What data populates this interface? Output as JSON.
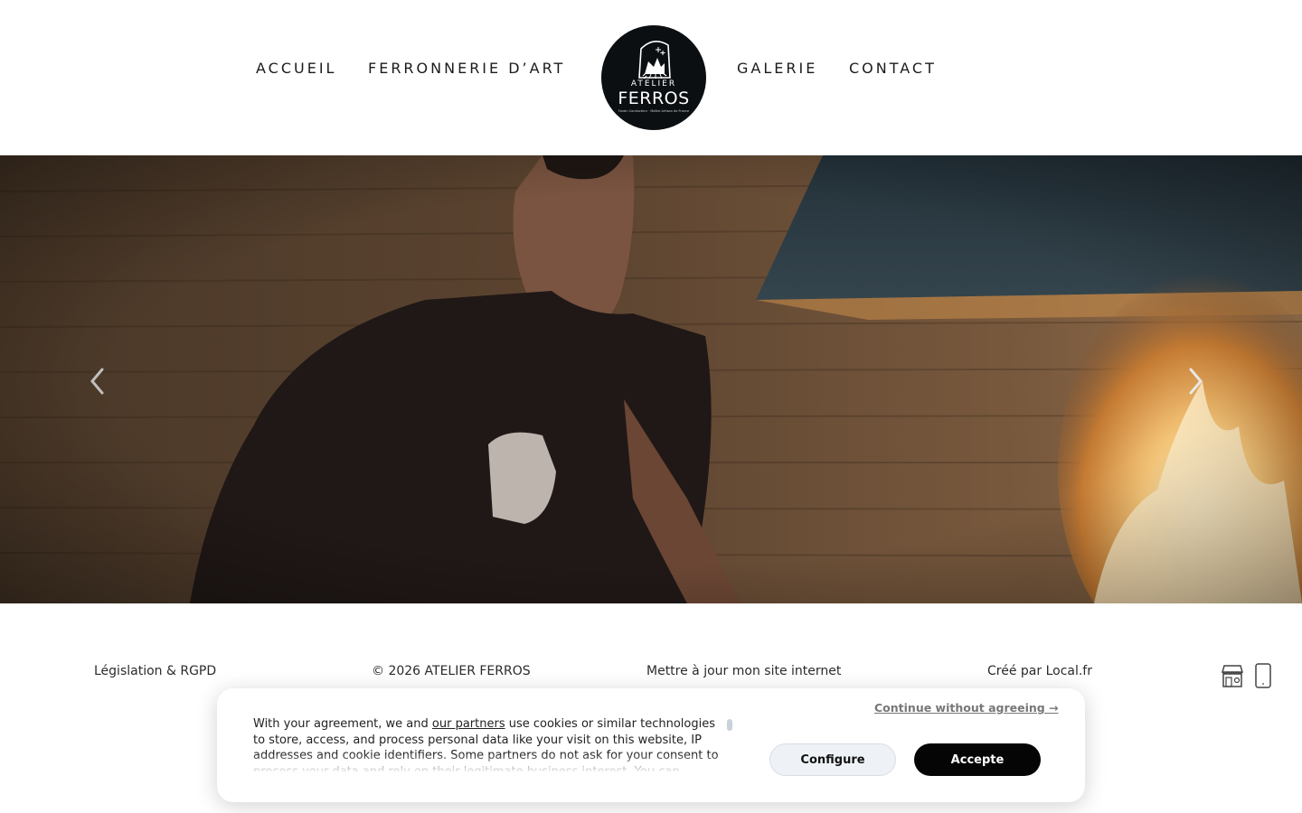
{
  "nav": {
    "items": [
      {
        "label": "ACCUEIL"
      },
      {
        "label": "FERRONNERIE D’ART"
      },
      {
        "label": "GALERIE"
      },
      {
        "label": "CONTACT"
      }
    ]
  },
  "logo": {
    "top": "ATELIER",
    "main": "FERROS",
    "sub": "Forain Conducteur · Maître Artisan de France",
    "icon": "anvil-fire-emblem"
  },
  "hero": {
    "prev_icon": "chevron-left-icon",
    "next_icon": "chevron-right-icon"
  },
  "footer": {
    "legal": "Législation & RGPD",
    "copyright": "© 2026 ATELIER FERROS",
    "update": "Mettre à jour mon site internet",
    "credit": "Créé par Local.fr",
    "icons": [
      "shop-icon",
      "mobile-icon"
    ]
  },
  "cookie": {
    "text_before": "With your agreement, we and ",
    "partners_link": "our partners",
    "text_after": " use cookies or similar technologies to store, access, and process personal data like your visit on this website, IP addresses and cookie identifiers. Some partners do not ask for your consent to process your data and rely on their legitimate business interest. You can",
    "continue": "Continue without agreeing →",
    "configure": "Configure",
    "accept": "Accepte"
  },
  "colors": {
    "accent": "#050505",
    "logo_bg": "#0b0f12",
    "configure_bg": "#eef2f6"
  }
}
